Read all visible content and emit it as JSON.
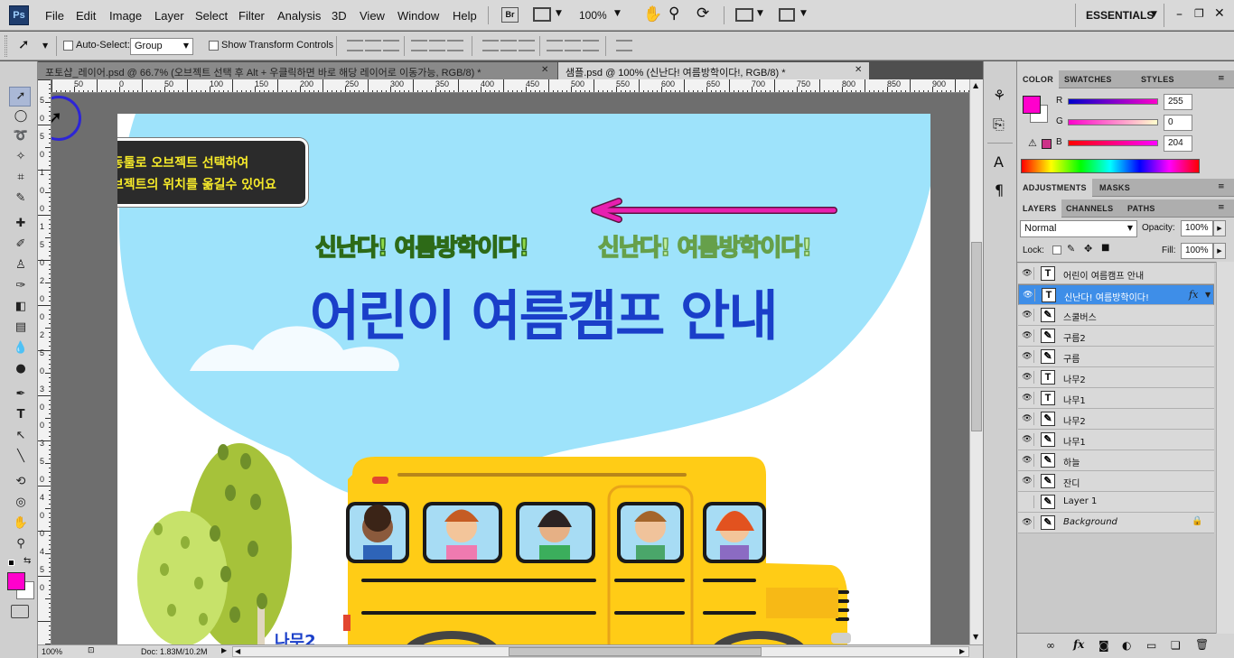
{
  "app": {
    "logo": "Ps",
    "workspace": "ESSENTIALS",
    "zoom_dropdown": "100%"
  },
  "menu": [
    "File",
    "Edit",
    "Image",
    "Layer",
    "Select",
    "Filter",
    "Analysis",
    "3D",
    "View",
    "Window",
    "Help"
  ],
  "options_bar": {
    "auto_select_label": "Auto-Select:",
    "auto_select_value": "Group",
    "show_transform_label": "Show Transform Controls"
  },
  "tabs": [
    {
      "label": "포토샵_레이어.psd @ 66.7% (오브젝트 선택 후 Alt + 우클릭하면 바로 해당 레이어로 이동가능, RGB/8) *",
      "active": false
    },
    {
      "label": "샘플.psd @ 100% (신난다! 여름방학이다!, RGB/8) *",
      "active": true
    }
  ],
  "ruler": {
    "h_ticks": [
      "50",
      "0",
      "50",
      "100",
      "150",
      "200",
      "250",
      "300",
      "350",
      "400",
      "450",
      "500",
      "550",
      "600",
      "650",
      "700",
      "750",
      "800",
      "850",
      "900"
    ],
    "v_ticks": [
      "5",
      "0",
      "5",
      "0",
      "1",
      "0",
      "0",
      "1",
      "5",
      "0",
      "2",
      "0",
      "0",
      "2",
      "5",
      "0",
      "3",
      "0",
      "0",
      "3",
      "5",
      "0",
      "4",
      "0",
      "0",
      "4",
      "5",
      "0"
    ]
  },
  "canvas": {
    "tooltip_line1": "이동툴로 오브젝트 선택하여",
    "tooltip_line2": "오브젝트의 위치를 옮길수 있어요",
    "subtitle_left": "신난다! 여름방학이다!",
    "subtitle_right": "신난다! 여름방학이다!",
    "title": "어린이 여름캠프 안내",
    "bottom_label": "나무2",
    "colors": {
      "sky": "#9ee3fb",
      "title": "#1a3fc9",
      "subtitle_fill": "#8fd84a",
      "subtitle_right_fill": "#bfeea0",
      "arrow": "#e81fb0",
      "bus": "#ffcc16"
    }
  },
  "status": {
    "zoom": "100%",
    "doc": "Doc: 1.83M/10.2M"
  },
  "color_panel": {
    "tabs": [
      "COLOR",
      "SWATCHES",
      "STYLES"
    ],
    "r_label": "R",
    "r_value": "255",
    "g_label": "G",
    "g_value": "0",
    "b_label": "B",
    "b_value": "204",
    "foreground": "#ff00cc"
  },
  "adjustments_panel": {
    "tabs": [
      "ADJUSTMENTS",
      "MASKS"
    ]
  },
  "layers_panel": {
    "tabs": [
      "LAYERS",
      "CHANNELS",
      "PATHS"
    ],
    "blend_mode": "Normal",
    "opacity_label": "Opacity:",
    "opacity_value": "100%",
    "lock_label": "Lock:",
    "fill_label": "Fill:",
    "fill_value": "100%",
    "layers": [
      {
        "name": "어린이 여름캠프 안내",
        "type": "text",
        "visible": true,
        "selected": false
      },
      {
        "name": "신난다! 여름방학이다!",
        "type": "text",
        "visible": true,
        "selected": true,
        "fx": "fx"
      },
      {
        "name": "스쿨버스",
        "type": "brush",
        "visible": true,
        "selected": false
      },
      {
        "name": "구름2",
        "type": "brush",
        "visible": true,
        "selected": false
      },
      {
        "name": "구름",
        "type": "brush",
        "visible": true,
        "selected": false
      },
      {
        "name": "나무2",
        "type": "text",
        "visible": true,
        "selected": false
      },
      {
        "name": "나무1",
        "type": "text",
        "visible": true,
        "selected": false
      },
      {
        "name": "나무2",
        "type": "brush",
        "visible": true,
        "selected": false
      },
      {
        "name": "나무1",
        "type": "brush",
        "visible": true,
        "selected": false
      },
      {
        "name": "하늘",
        "type": "brush",
        "visible": true,
        "selected": false
      },
      {
        "name": "잔디",
        "type": "brush",
        "visible": true,
        "selected": false
      },
      {
        "name": "Layer 1",
        "type": "brush",
        "visible": false,
        "selected": false
      },
      {
        "name": "Background",
        "type": "brush",
        "visible": true,
        "selected": false,
        "locked": true
      }
    ]
  }
}
